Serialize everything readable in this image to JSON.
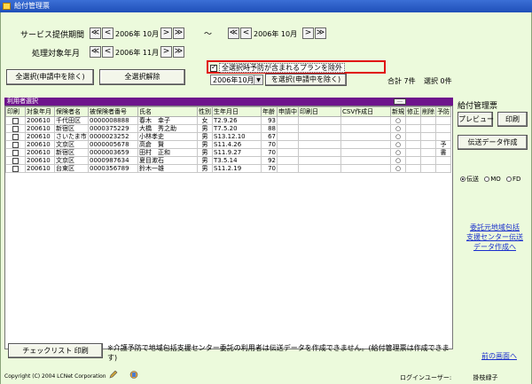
{
  "window": {
    "title": "給付管理票"
  },
  "service_period": {
    "label": "サービス提供期間",
    "from": "2006年 10月",
    "to": "2006年 10月",
    "tilde": "〜"
  },
  "process_month": {
    "label": "処理対象年月",
    "value": "2006年 11月"
  },
  "nav": {
    "first": "≪",
    "prev": "<",
    "next": ">",
    "last": "≫"
  },
  "buttons": {
    "select_all": "全選択(申請中を除く)",
    "deselect_all": "全選択解除",
    "select_month": "を選択(申請中を除く)",
    "preview": "プレビュー",
    "print": "印刷",
    "transmit": "伝送データ作成",
    "checklist": "チェックリスト 印刷",
    "more": "…"
  },
  "option": {
    "exclude_prevention": "全選択時予防が含まれるプランを除外"
  },
  "month_select": {
    "value": "2006年10月分"
  },
  "summary": {
    "total": "合計 7件",
    "selected": "選択 0件"
  },
  "section": {
    "title": "利用者選択"
  },
  "table": {
    "headers": [
      "印刷",
      "対象年月",
      "保険者名",
      "被保険者番号",
      "氏名",
      "性別",
      "生年月日",
      "年齢",
      "申請中",
      "印刷日",
      "CSV作成日",
      "新規",
      "修正",
      "削除",
      "予防"
    ],
    "rows": [
      [
        "200610",
        "千代田区",
        "0000008888",
        "春木　幸子",
        "女",
        "T2.9.26",
        "93",
        "",
        "",
        "",
        "○",
        "",
        "",
        ""
      ],
      [
        "200610",
        "新宿区",
        "0000375229",
        "大橋　秀之助",
        "男",
        "T7.5.20",
        "88",
        "",
        "",
        "",
        "○",
        "",
        "",
        ""
      ],
      [
        "200610",
        "さいたま市",
        "0000023252",
        "小林孝史",
        "男",
        "S13.12.10",
        "67",
        "",
        "",
        "",
        "○",
        "",
        "",
        ""
      ],
      [
        "200610",
        "文京区",
        "0000005678",
        "高倉　賢",
        "男",
        "S11.4.26",
        "70",
        "",
        "",
        "",
        "○",
        "",
        "",
        "予"
      ],
      [
        "200610",
        "新宿区",
        "0000003659",
        "田村　正和",
        "男",
        "S11.9.27",
        "70",
        "",
        "",
        "",
        "○",
        "",
        "",
        "書"
      ],
      [
        "200610",
        "文京区",
        "0000987634",
        "夏目漱石",
        "男",
        "T3.5.14",
        "92",
        "",
        "",
        "",
        "○",
        "",
        "",
        ""
      ],
      [
        "200610",
        "台東区",
        "0000356789",
        "鈴木一雄",
        "男",
        "S11.2.19",
        "70",
        "",
        "",
        "",
        "○",
        "",
        "",
        ""
      ]
    ]
  },
  "side": {
    "title": "給付管理票",
    "radios": [
      "伝送",
      "MO",
      "FD"
    ],
    "link_lines": [
      "委託元地域包括",
      "支援センター伝送",
      "データ作成へ"
    ],
    "back": "前の画面へ"
  },
  "note": "※介護予防で地域包括支援センター委託の利用者は伝送データを作成できません。(給付管理票は作成できます)",
  "footer": {
    "copyright": "Copyright (C) 2004 LCNet Corporation",
    "login_label": "ログインユーザー:",
    "login_user": "掛枝緑子"
  }
}
